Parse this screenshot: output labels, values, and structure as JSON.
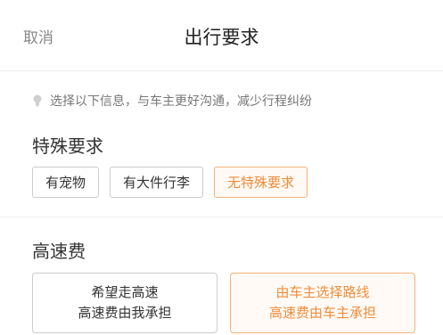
{
  "header": {
    "cancel_label": "取消",
    "title": "出行要求"
  },
  "tip": {
    "icon": "bulb-icon",
    "text": "选择以下信息，与车主更好沟通，减少行程纠纷"
  },
  "special_requirements": {
    "title": "特殊要求",
    "chips": [
      {
        "label": "有宠物",
        "selected": false
      },
      {
        "label": "有大件行李",
        "selected": false
      },
      {
        "label": "无特殊要求",
        "selected": true
      }
    ]
  },
  "toll": {
    "title": "高速费",
    "options": [
      {
        "line1": "希望走高速",
        "line2": "高速费由我承担",
        "selected": false
      },
      {
        "line1": "由车主选择路线",
        "line2": "高速费由车主承担",
        "selected": true
      }
    ]
  },
  "colors": {
    "accent": "#f08c3a",
    "accent_border": "#f5b27a",
    "border": "#cccccc",
    "muted_text": "#888888"
  }
}
